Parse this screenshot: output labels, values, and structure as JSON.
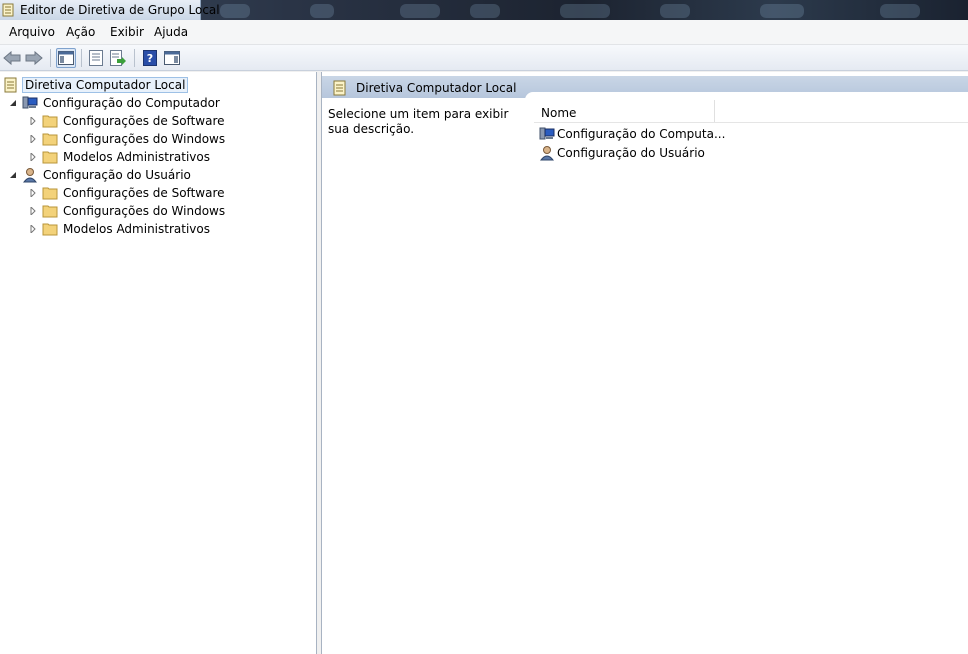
{
  "window": {
    "title": "Editor de Diretiva de Grupo Local"
  },
  "menu": [
    "Arquivo",
    "Ação",
    "Exibir",
    "Ajuda"
  ],
  "tree": {
    "root": "Diretiva Computador Local",
    "computer": {
      "label": "Configuração do Computador",
      "children": [
        "Configurações de Software",
        "Configurações do Windows",
        "Modelos Administrativos"
      ]
    },
    "user": {
      "label": "Configuração do Usuário",
      "children": [
        "Configurações de Software",
        "Configurações do Windows",
        "Modelos Administrativos"
      ]
    }
  },
  "details": {
    "title": "Diretiva Computador Local",
    "description": "Selecione um item para exibir sua descrição.",
    "column_name": "Nome",
    "items": [
      "Configuração do Computa...",
      "Configuração do Usuário"
    ]
  },
  "colors": {
    "selection_bg": "#e8f1fb",
    "selection_border": "#9ec1e6",
    "header_bg": "#c9d6e6"
  }
}
